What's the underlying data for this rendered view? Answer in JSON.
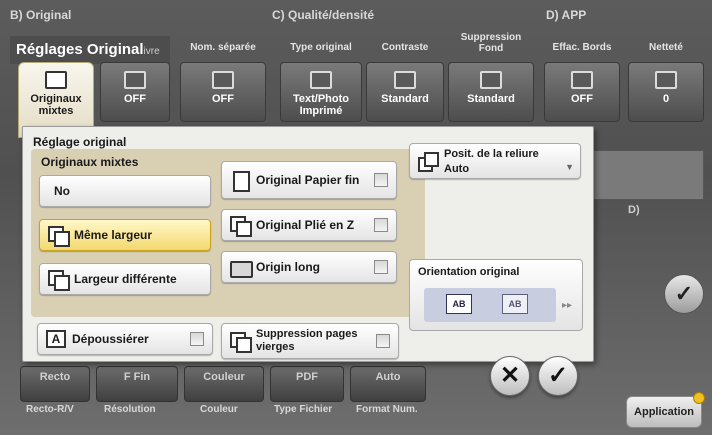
{
  "background": {
    "sections": [
      {
        "label": "B) Original"
      },
      {
        "label": "C) Qualité/densité"
      },
      {
        "label": "D) APP"
      }
    ],
    "title": "Réglages Original",
    "title_suffix": "ivre",
    "columns": [
      {
        "header": "Nom. séparée",
        "value": "OFF"
      },
      {
        "header": "Type original",
        "value": "Text/Photo Imprimé"
      },
      {
        "header": "Contraste",
        "value": "Standard"
      },
      {
        "header": "Suppression Fond",
        "value": "Standard"
      },
      {
        "header": "Effac. Bords",
        "value": "OFF"
      },
      {
        "header": "Netteté",
        "value": "0"
      }
    ],
    "originaux_tab": "Originaux mixtes",
    "mid_tab_value": "OFF",
    "bottom_buttons": [
      "Recto",
      "F Fin",
      "Couleur",
      "PDF",
      "Auto"
    ],
    "bottom_labels": [
      "Recto-R/V",
      "Résolution",
      "Couleur",
      "Type Fichier",
      "Format Num."
    ],
    "application_button": "Application",
    "right_partial": "D)"
  },
  "panel": {
    "title": "Réglage original",
    "mixed_group": {
      "title": "Originaux mixtes",
      "options": [
        {
          "label": "No",
          "selected": false
        },
        {
          "label": "Même largeur",
          "selected": true
        },
        {
          "label": "Largeur différente",
          "selected": false
        }
      ]
    },
    "checkbox_options": [
      {
        "label": "Original Papier fin",
        "checked": false
      },
      {
        "label": "Original Plié en Z",
        "checked": false
      },
      {
        "label": "Origin long",
        "checked": false
      }
    ],
    "binding": {
      "label": "Posit. de la reliure",
      "value": "Auto"
    },
    "orientation": {
      "title": "Orientation original",
      "images": [
        "AB",
        "AB"
      ]
    },
    "despeckle": {
      "label": "Dépoussiérer",
      "checked": false
    },
    "blank_removal": {
      "label": "Suppression pages vierges",
      "checked": false
    }
  },
  "actions": {
    "cancel_symbol": "✕",
    "ok_symbol": "✓"
  },
  "colors": {
    "selected_fill": "#f3d870",
    "group_background": "#d9cfb3",
    "panel_background": "#eeeeea"
  }
}
